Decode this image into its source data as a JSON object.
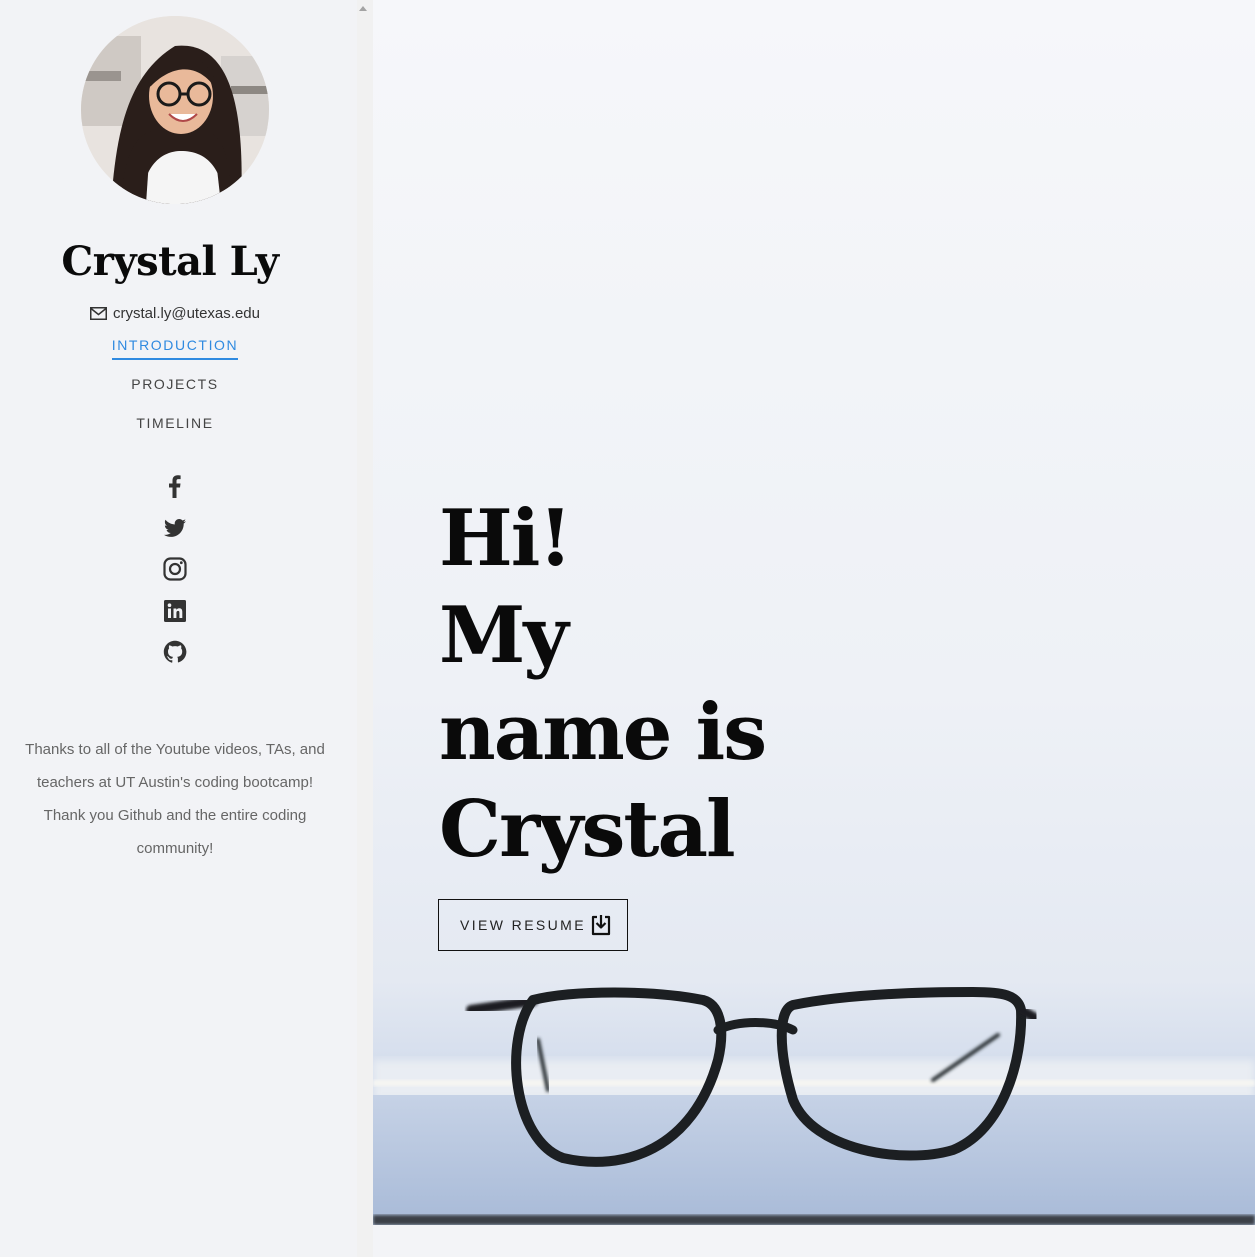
{
  "profile": {
    "name": "Crystal Ly",
    "email": "crystal.ly@utexas.edu",
    "avatar_alt": "profile photo"
  },
  "nav": {
    "items": [
      {
        "label": "INTRODUCTION",
        "active": true
      },
      {
        "label": "PROJECTS",
        "active": false
      },
      {
        "label": "TIMELINE",
        "active": false
      }
    ]
  },
  "social": {
    "icons": [
      "facebook-icon",
      "twitter-icon",
      "instagram-icon",
      "linkedin-icon",
      "github-icon"
    ]
  },
  "thanks": {
    "text": "Thanks to all of the Youtube videos, TAs, and teachers at UT Austin's coding bootcamp! Thank you Github and the entire coding community!"
  },
  "hero": {
    "lines": [
      "Hi!",
      "My",
      "name is",
      "Crystal"
    ],
    "button_label": "VIEW RESUME"
  },
  "colors": {
    "accent": "#2f8ae0",
    "sidebar_bg": "#f2f3f6",
    "text_dark": "#0a0a0a"
  }
}
